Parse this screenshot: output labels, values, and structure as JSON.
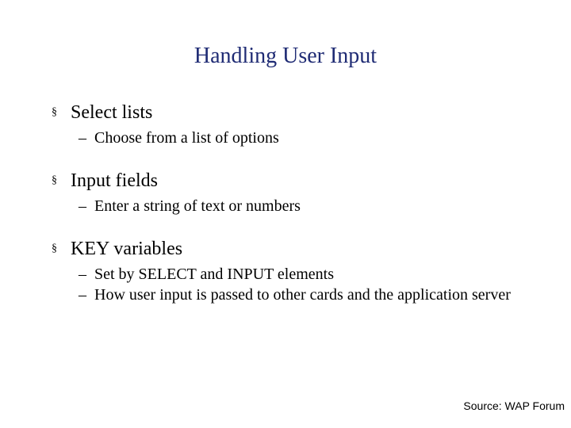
{
  "title": "Handling User Input",
  "bullets": [
    {
      "label": "Select lists",
      "subs": [
        "Choose from a list of options"
      ]
    },
    {
      "label": "Input fields",
      "subs": [
        "Enter a string of text or numbers"
      ]
    },
    {
      "label": "KEY variables",
      "subs": [
        "Set by SELECT and INPUT elements",
        "How user input is passed to other cards and the application server"
      ]
    }
  ],
  "footer": "Source: WAP Forum",
  "markers": {
    "level1": "§",
    "level2": "–"
  }
}
